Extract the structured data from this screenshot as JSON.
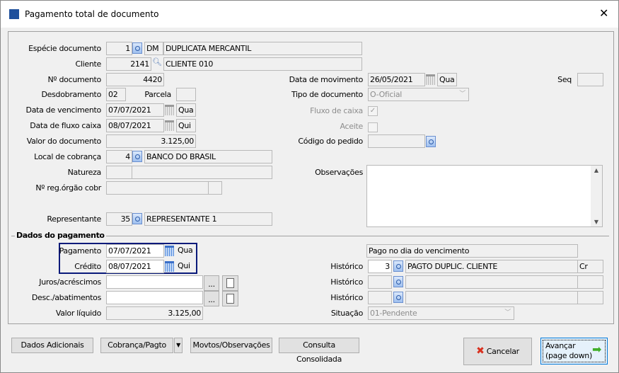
{
  "window": {
    "title": "Pagamento total de documento",
    "close": "✕"
  },
  "left": {
    "especie": {
      "label": "Espécie documento",
      "code": "1",
      "sigla": "DM",
      "desc": "DUPLICATA MERCANTIL"
    },
    "cliente": {
      "label": "Cliente",
      "code": "2141",
      "desc": "CLIENTE 010"
    },
    "numero": {
      "label": "Nº documento",
      "value": "4420"
    },
    "desdobramento": {
      "label": "Desdobramento",
      "value": "02"
    },
    "parcela": {
      "label": "Parcela",
      "value": ""
    },
    "vencimento": {
      "label": "Data de vencimento",
      "date": "07/07/2021",
      "day": "Qua"
    },
    "fluxo": {
      "label": "Data de fluxo caixa",
      "date": "08/07/2021",
      "day": "Qui"
    },
    "valor": {
      "label": "Valor do documento",
      "value": "3.125,00"
    },
    "local": {
      "label": "Local de cobrança",
      "code": "4",
      "desc": "BANCO DO BRASIL"
    },
    "natureza": {
      "label": "Natureza",
      "code": "",
      "desc": ""
    },
    "reg": {
      "label": "Nº reg.órgão cobr",
      "value": ""
    },
    "representante": {
      "label": "Representante",
      "code": "35",
      "desc": "REPRESENTANTE 1"
    }
  },
  "right": {
    "movimento": {
      "label": "Data de movimento",
      "date": "26/05/2021",
      "day": "Qua"
    },
    "seq": {
      "label": "Seq",
      "value": ""
    },
    "tipo": {
      "label": "Tipo de documento",
      "value": "O-Oficial"
    },
    "fluxo_caixa": {
      "label": "Fluxo de caixa",
      "checked": true,
      "mark": "✓"
    },
    "aceite": {
      "label": "Aceite",
      "checked": false
    },
    "pedido": {
      "label": "Código do pedido",
      "value": ""
    },
    "obs": {
      "label": "Observações",
      "value": ""
    }
  },
  "pagamento": {
    "group": "Dados do pagamento",
    "pagamento": {
      "label": "Pagamento",
      "date": "07/07/2021",
      "day": "Qua"
    },
    "credito": {
      "label": "Crédito",
      "date": "08/07/2021",
      "day": "Qui"
    },
    "juros": {
      "label": "Juros/acréscimos",
      "value": ""
    },
    "desc": {
      "label": "Desc./abatimentos",
      "value": ""
    },
    "liquido": {
      "label": "Valor líquido",
      "value": "3.125,00"
    },
    "info": "Pago no dia do vencimento",
    "historicos": [
      {
        "label": "Histórico",
        "code": "3",
        "desc": "PAGTO DUPLIC. CLIENTE",
        "dc": "Cr"
      },
      {
        "label": "Histórico",
        "code": "",
        "desc": "",
        "dc": ""
      },
      {
        "label": "Histórico",
        "code": "",
        "desc": "",
        "dc": ""
      }
    ],
    "situacao": {
      "label": "Situação",
      "value": "01-Pendente"
    },
    "ellipsis": "..."
  },
  "buttons": {
    "dados": "Dados Adicionais",
    "cobranca": "Cobrança/Pagto",
    "movtos": "Movtos/Observações",
    "consulta": "Consulta Consolidada",
    "cancelar": "Cancelar",
    "avancar1": "Avançar",
    "avancar2": "(page down)"
  },
  "colors": {
    "highlight_border": "#0a1a7a",
    "cancel_icon": "#d9301e",
    "next_icon": "#3fae29"
  }
}
